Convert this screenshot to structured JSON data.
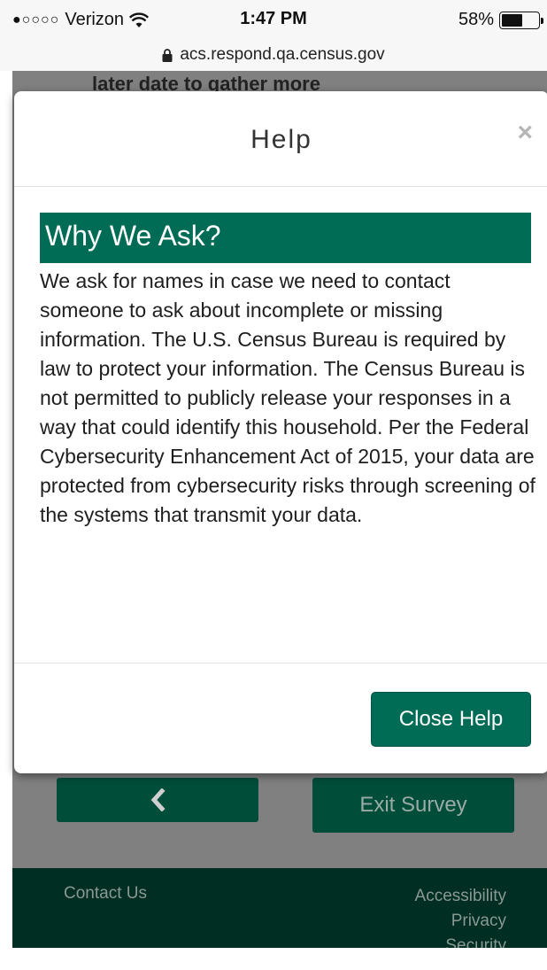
{
  "status_bar": {
    "signal": "●○○○○",
    "carrier": "Verizon",
    "wifi_icon": "wifi-icon",
    "time": "1:47 PM",
    "battery": "58%",
    "battery_level": 0.58
  },
  "url_bar": {
    "lock_icon": "lock-icon",
    "url": "acs.respond.qa.census.gov"
  },
  "background_page": {
    "peek_text": "later date to gather more",
    "back_icon": "‹",
    "exit_label": "Exit Survey",
    "footer": {
      "contact": "Contact Us",
      "links": [
        "Accessibility",
        "Privacy",
        "Security"
      ]
    }
  },
  "modal": {
    "title": "Help",
    "close_icon": "×",
    "heading": "Why We Ask?",
    "body": "We ask for names in case we need to contact someone to ask about incomplete or missing information. The U.S. Census Bureau is required by law to protect your information. The Census Bureau is not permitted to publicly release your responses in a way that could identify this household. Per the Federal Cybersecurity Enhancement Act of 2015, your data are protected from cybersecurity risks through screening of the systems that transmit your data.",
    "close_button": "Close Help"
  },
  "colors": {
    "accent": "#006c56",
    "dark_green": "#004d3a",
    "footer": "#002e22"
  }
}
